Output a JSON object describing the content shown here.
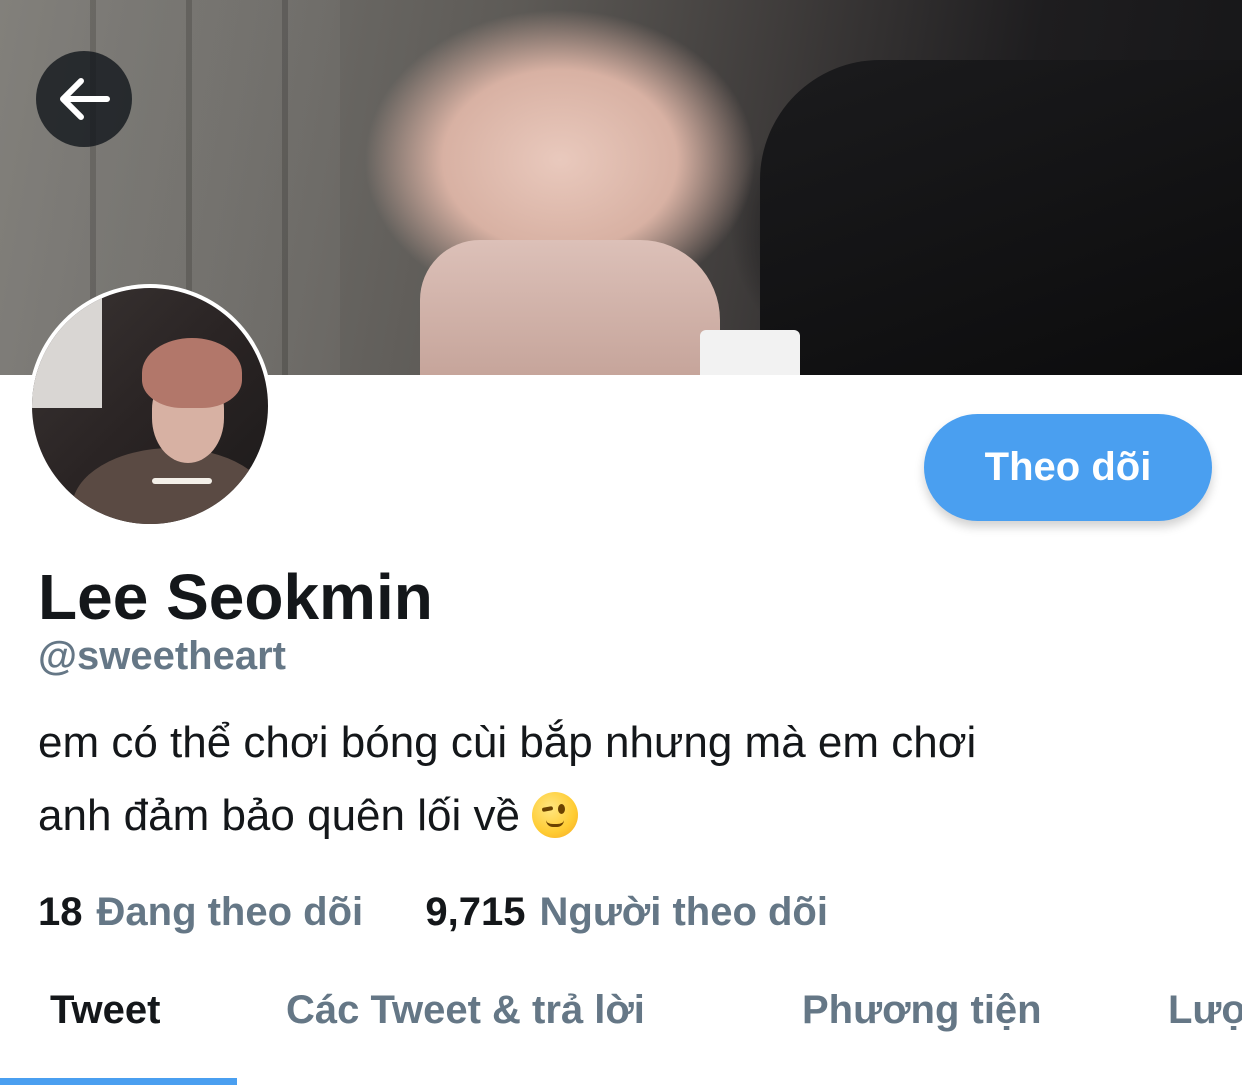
{
  "profile": {
    "display_name": "Lee Seokmin",
    "handle": "@sweetheart",
    "bio_line1": "em có thể chơi bóng cùi bắp nhưng mà em chơi",
    "bio_line2": "anh đảm bảo quên lối về"
  },
  "actions": {
    "follow_label": "Theo dõi"
  },
  "stats": {
    "following_count": "18",
    "following_label": "Đang theo dõi",
    "followers_count": "9,715",
    "followers_label": "Người theo dõi"
  },
  "tabs": [
    {
      "label": "Tweet",
      "active": true
    },
    {
      "label": "Các Tweet & trả lời",
      "active": false
    },
    {
      "label": "Phương tiện",
      "active": false
    },
    {
      "label": "Lượt thích",
      "active": false
    }
  ],
  "icons": {
    "back": "arrow-left-icon",
    "bio_emoji": "winking-face-emoji"
  },
  "colors": {
    "accent": "#4a9ff0",
    "secondary_text": "#657786",
    "primary_text": "#14171a"
  }
}
